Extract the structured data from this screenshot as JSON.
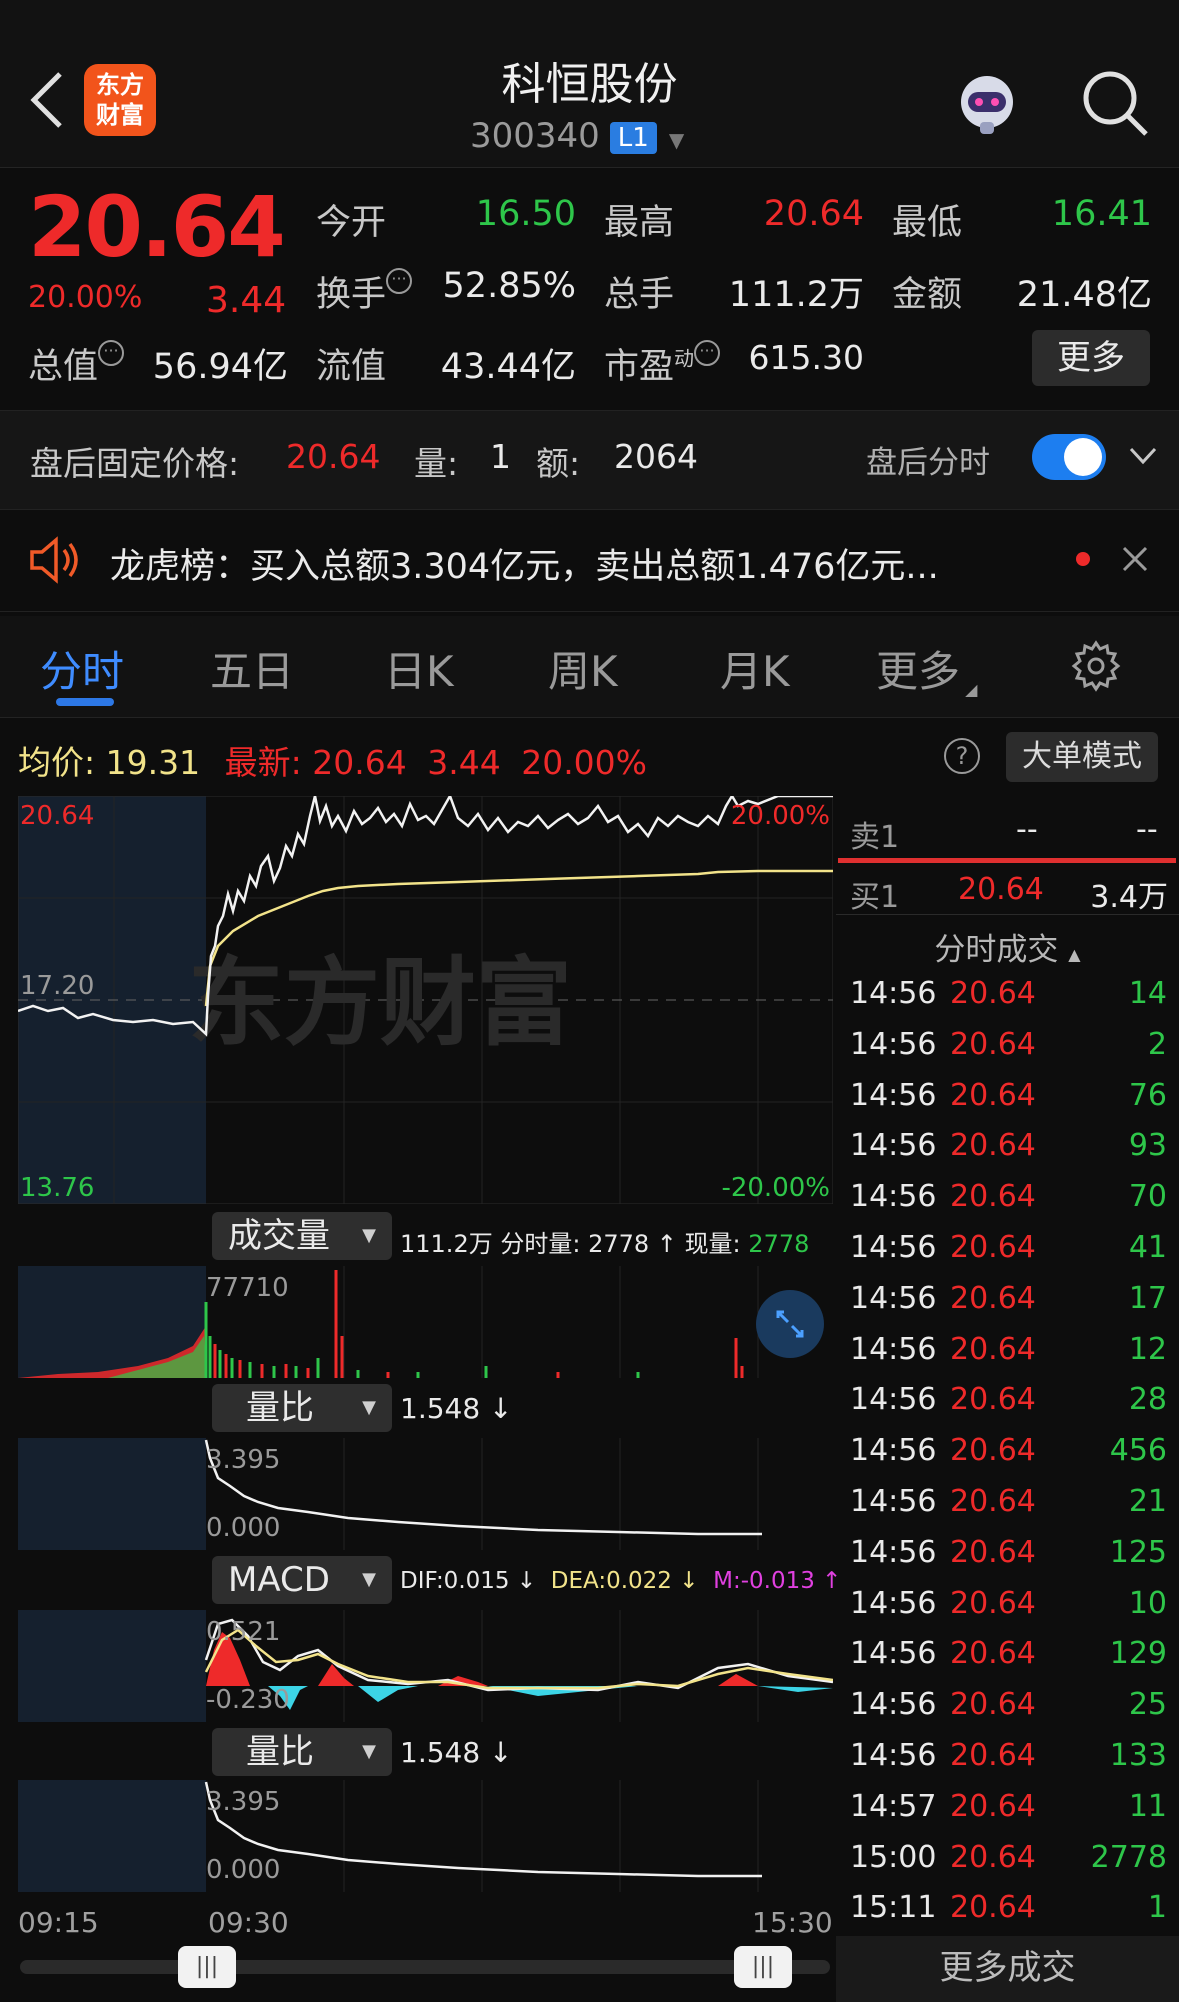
{
  "header": {
    "title": "科恒股份",
    "code": "300340",
    "level": "L1",
    "logo_line1": "东方",
    "logo_line2": "财富"
  },
  "quote": {
    "price": "20.64",
    "change_pct": "20.00%",
    "change": "3.44",
    "open_label": "今开",
    "open": "16.50",
    "high_label": "最高",
    "high": "20.64",
    "low_label": "最低",
    "low": "16.41",
    "turnover_label": "换手",
    "turnover": "52.85%",
    "volume_label": "总手",
    "volume": "111.2万",
    "amount_label": "金额",
    "amount": "21.48亿",
    "mcap_label": "总值",
    "mcap": "56.94亿",
    "float_label": "流值",
    "float_cap": "43.44亿",
    "pe_label": "市盈",
    "pe_sup": "动",
    "pe": "615.30",
    "more_label": "更多"
  },
  "after_hours": {
    "label": "盘后固定价格:",
    "price": "20.64",
    "vol_label": "量:",
    "vol": "1",
    "amt_label": "额:",
    "amt": "2064",
    "toggle_label": "盘后分时",
    "toggle_on": true
  },
  "news": {
    "text": "龙虎榜：买入总额3.304亿元，卖出总额1.476亿元..."
  },
  "tabs": [
    {
      "label": "分时",
      "active": true
    },
    {
      "label": "五日"
    },
    {
      "label": "日K"
    },
    {
      "label": "周K"
    },
    {
      "label": "月K"
    },
    {
      "label": "更多"
    }
  ],
  "avg_row": {
    "avg_label": "均价:",
    "avg": "19.31",
    "latest_label": "最新:",
    "latest": "20.64",
    "chg": "3.44",
    "pct": "20.00%",
    "big_order_label": "大单模式"
  },
  "price_chart": {
    "top_price": "20.64",
    "mid_price": "17.20",
    "bottom_price": "13.76",
    "top_pct": "20.00%",
    "bottom_pct": "-20.00%",
    "watermark": "东方财富"
  },
  "volume_panel": {
    "indicator": "成交量",
    "info_total": "111.2万",
    "info_label": "分时量:",
    "info_val": "2778 ↑",
    "info_now_label": "现量:",
    "info_now": "2778",
    "max_label": "77710"
  },
  "ratio_panel_1": {
    "indicator": "量比",
    "value": "1.548 ↓",
    "max_label": "3.395",
    "min_label": "0.000"
  },
  "macd_panel": {
    "indicator": "MACD",
    "dif": "DIF:0.015 ↓",
    "dea": "DEA:0.022 ↓",
    "m": "M:-0.013 ↑",
    "max_label": "0.521",
    "min_label": "-0.230"
  },
  "ratio_panel_2": {
    "indicator": "量比",
    "value": "1.548 ↓",
    "max_label": "3.395",
    "min_label": "0.000"
  },
  "time_axis": [
    "09:15",
    "09:30",
    "15:30"
  ],
  "order_book": {
    "sell1_label": "卖1",
    "sell1_price": "--",
    "sell1_vol": "--",
    "buy1_label": "买1",
    "buy1_price": "20.64",
    "buy1_vol": "3.4万"
  },
  "trades_title": "分时成交",
  "trades": [
    {
      "time": "14:56",
      "price": "20.64",
      "vol": "14"
    },
    {
      "time": "14:56",
      "price": "20.64",
      "vol": "2"
    },
    {
      "time": "14:56",
      "price": "20.64",
      "vol": "76"
    },
    {
      "time": "14:56",
      "price": "20.64",
      "vol": "93"
    },
    {
      "time": "14:56",
      "price": "20.64",
      "vol": "70"
    },
    {
      "time": "14:56",
      "price": "20.64",
      "vol": "41"
    },
    {
      "time": "14:56",
      "price": "20.64",
      "vol": "17"
    },
    {
      "time": "14:56",
      "price": "20.64",
      "vol": "12"
    },
    {
      "time": "14:56",
      "price": "20.64",
      "vol": "28"
    },
    {
      "time": "14:56",
      "price": "20.64",
      "vol": "456"
    },
    {
      "time": "14:56",
      "price": "20.64",
      "vol": "21"
    },
    {
      "time": "14:56",
      "price": "20.64",
      "vol": "125"
    },
    {
      "time": "14:56",
      "price": "20.64",
      "vol": "10"
    },
    {
      "time": "14:56",
      "price": "20.64",
      "vol": "129"
    },
    {
      "time": "14:56",
      "price": "20.64",
      "vol": "25"
    },
    {
      "time": "14:56",
      "price": "20.64",
      "vol": "133"
    },
    {
      "time": "14:57",
      "price": "20.64",
      "vol": "11"
    },
    {
      "time": "15:00",
      "price": "20.64",
      "vol": "2778"
    },
    {
      "time": "15:11",
      "price": "20.64",
      "vol": "1"
    }
  ],
  "more_trades_label": "更多成交",
  "colors": {
    "up": "#ee2a2a",
    "down": "#2ec64a",
    "accent": "#2d78e6",
    "avg_line": "#f2e38a",
    "macd_neg": "#3cd4e6"
  }
}
